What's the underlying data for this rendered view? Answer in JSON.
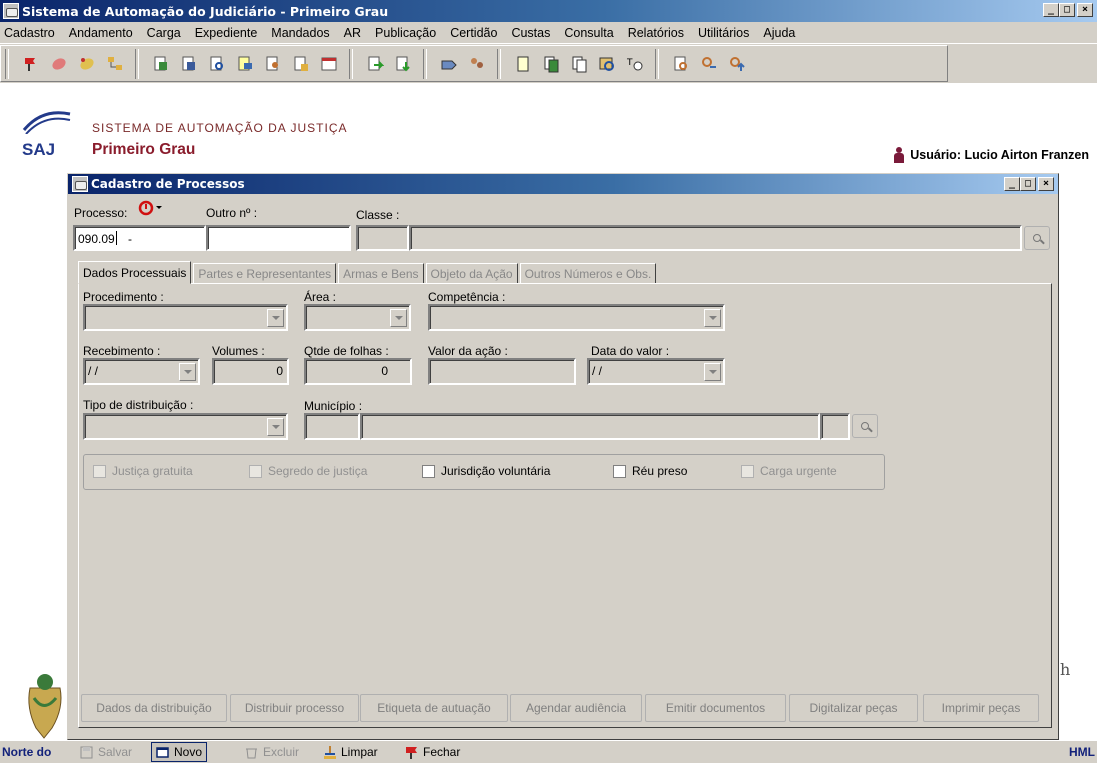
{
  "window": {
    "title": "Sistema de Automação do Judiciário - Primeiro Grau"
  },
  "menu": [
    "Cadastro",
    "Andamento",
    "Carga",
    "Expediente",
    "Mandados",
    "AR",
    "Publicação",
    "Certidão",
    "Custas",
    "Consulta",
    "Relatórios",
    "Utilitários",
    "Ajuda"
  ],
  "banner": {
    "sistema": "SISTEMA DE AUTOMAÇÃO DA JUSTIÇA",
    "grau": "Primeiro Grau",
    "saj": "SAJ",
    "user": "Usuário: Lucio Airton Franzen"
  },
  "form": {
    "title": "Cadastro de Processos",
    "processo_label": "Processo:",
    "processo_value": "090.09",
    "processo_suffix": " -",
    "outro_label": "Outro nº :",
    "classe_label": "Classe :"
  },
  "tabs": [
    "Dados Processuais",
    "Partes e Representantes",
    "Armas e Bens",
    "Objeto da Ação",
    "Outros Números e Obs."
  ],
  "fields": {
    "procedimento": "Procedimento :",
    "area": "Área :",
    "competencia": "Competência :",
    "recebimento": "Recebimento :",
    "recebimento_value": "/ /",
    "volumes": "Volumes :",
    "volumes_value": "0",
    "folhas": "Qtde de folhas :",
    "folhas_value": "0",
    "valor": "Valor da ação :",
    "data_valor": "Data do valor :",
    "data_valor_value": "/ /",
    "tipo_dist": "Tipo de distribuição :",
    "municipio": "Município :"
  },
  "checkboxes": [
    {
      "label": "Justiça gratuita",
      "enabled": false
    },
    {
      "label": "Segredo de justiça",
      "enabled": false
    },
    {
      "label": "Jurisdição voluntária",
      "enabled": true
    },
    {
      "label": "Réu preso",
      "enabled": true
    },
    {
      "label": "Carga urgente",
      "enabled": false
    }
  ],
  "bottom_buttons": [
    "Dados da distribuição",
    "Distribuir processo",
    "Etiqueta de autuação",
    "Agendar audiência",
    "Emitir documentos",
    "Digitalizar peças",
    "Imprimir peças"
  ],
  "statusbar": {
    "left": "Norte do",
    "right": "HML",
    "actions": [
      "Salvar",
      "Novo",
      "Excluir",
      "Limpar",
      "Fechar"
    ]
  },
  "colors": {
    "title_start": "#0a246a",
    "title_end": "#a6caf0",
    "brand": "#8a1c2c",
    "saj_blue": "#233a8a"
  }
}
